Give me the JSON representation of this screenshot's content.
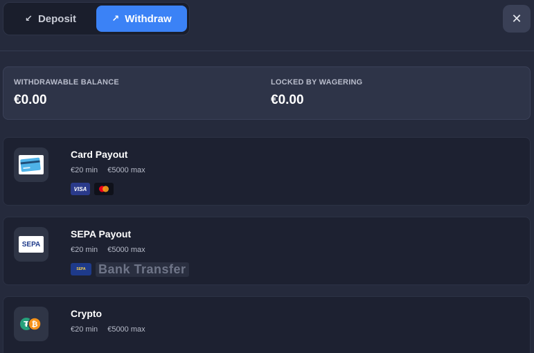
{
  "tabs": {
    "deposit": {
      "label": "Deposit",
      "icon": "arrow-down-left-icon"
    },
    "withdraw": {
      "label": "Withdraw",
      "icon": "arrow-up-right-icon",
      "active": true
    }
  },
  "close": {
    "icon": "close-icon"
  },
  "balance": {
    "withdrawable_label": "WITHDRAWABLE BALANCE",
    "withdrawable_value": "€0.00",
    "locked_label": "LOCKED BY WAGERING",
    "locked_value": "€0.00"
  },
  "methods": [
    {
      "title": "Card Payout",
      "min": "€20 min",
      "max": "€5000 max",
      "logo": "credit-card-icon",
      "badges": [
        "VISA",
        "mastercard-icon"
      ]
    },
    {
      "title": "SEPA Payout",
      "min": "€20 min",
      "max": "€5000 max",
      "logo": "SEPA",
      "badge_text": "Bank Transfer",
      "badge_logo": "SEPA"
    },
    {
      "title": "Crypto",
      "min": "€20 min",
      "max": "€5000 max",
      "logo": "crypto-coins-icon"
    }
  ],
  "colors": {
    "background": "#252a3c",
    "accent": "#3b82f6",
    "card": "#1d2131"
  }
}
